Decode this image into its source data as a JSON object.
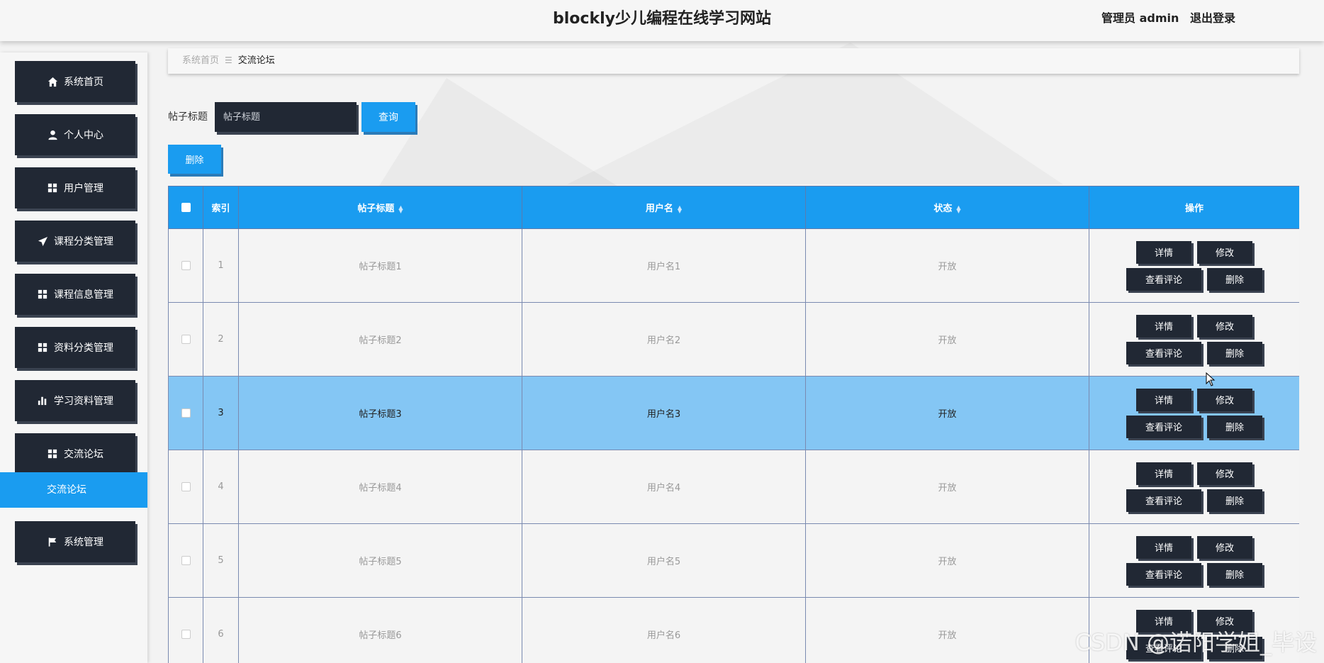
{
  "header": {
    "title": "blockly少儿编程在线学习网站",
    "user_role": "管理员 admin",
    "logout": "退出登录"
  },
  "sidebar": {
    "items": [
      {
        "label": "系统首页",
        "icon": "home-icon"
      },
      {
        "label": "个人中心",
        "icon": "user-icon"
      },
      {
        "label": "用户管理",
        "icon": "grid-icon"
      },
      {
        "label": "课程分类管理",
        "icon": "send-icon"
      },
      {
        "label": "课程信息管理",
        "icon": "grid-icon"
      },
      {
        "label": "资料分类管理",
        "icon": "grid-icon"
      },
      {
        "label": "学习资料管理",
        "icon": "bar-chart-icon"
      },
      {
        "label": "交流论坛",
        "icon": "grid-icon"
      },
      {
        "label": "系统管理",
        "icon": "flag-icon"
      }
    ],
    "submenu_active": "交流论坛"
  },
  "breadcrumb": {
    "home": "系统首页",
    "separator": "☰",
    "current": "交流论坛"
  },
  "search": {
    "label": "帖子标题",
    "placeholder": "帖子标题",
    "query_button": "查询"
  },
  "actions": {
    "delete_button": "删除"
  },
  "table": {
    "headers": {
      "index": "索引",
      "title": "帖子标题",
      "username": "用户名",
      "status": "状态",
      "ops": "操作"
    },
    "op_labels": {
      "detail": "详情",
      "edit": "修改",
      "comments": "查看评论",
      "delete": "删除"
    },
    "rows": [
      {
        "index": "1",
        "title": "帖子标题1",
        "username": "用户名1",
        "status": "开放",
        "selected": false
      },
      {
        "index": "2",
        "title": "帖子标题2",
        "username": "用户名2",
        "status": "开放",
        "selected": false
      },
      {
        "index": "3",
        "title": "帖子标题3",
        "username": "用户名3",
        "status": "开放",
        "selected": true
      },
      {
        "index": "4",
        "title": "帖子标题4",
        "username": "用户名4",
        "status": "开放",
        "selected": false
      },
      {
        "index": "5",
        "title": "帖子标题5",
        "username": "用户名5",
        "status": "开放",
        "selected": false
      },
      {
        "index": "6",
        "title": "帖子标题6",
        "username": "用户名6",
        "status": "开放",
        "selected": false
      }
    ]
  },
  "watermark": "CSDN @诺阳学姐_毕设",
  "colors": {
    "accent": "#1a9cf0",
    "dark": "#212834",
    "selected_row": "#84c6f4"
  }
}
